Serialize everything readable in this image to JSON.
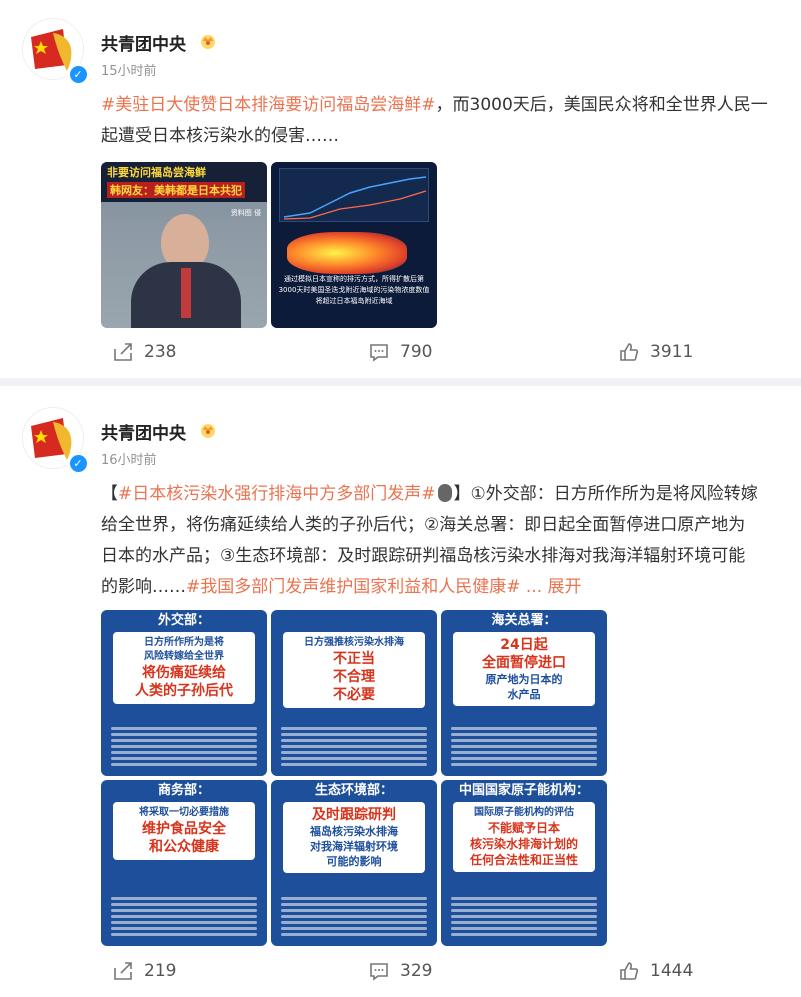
{
  "posts": [
    {
      "username": "共青团中央",
      "time": "15小时前",
      "content": {
        "topic": "#美驻日大使赞日本排海要访问福岛尝海鲜#",
        "text": "，而3000天后，美国民众将和全世界人民一起遭受日本核污染水的侵害……"
      },
      "images": [
        {
          "line1": "非要访问福岛尝海鲜",
          "line2": "韩网友：美韩都是日本共犯",
          "tag": "资料图 侵"
        },
        {
          "caption": "通过模拟日本宣称的排污方式，所得扩散后第3000天时美国圣迭戈附近海域的污染物浓度数值将超过日本福岛附近海域"
        }
      ],
      "actions": {
        "share": "238",
        "comment": "790",
        "like": "3911"
      }
    },
    {
      "username": "共青团中央",
      "time": "16小时前",
      "content": {
        "prefix": "【",
        "topic1": "#日本核污染水强行排海中方多部门发声#",
        "mid": "】①外交部：日方所作所为是将风险转嫁给全世界，将伤痛延续给人类的子孙后代；②海关总署：即日起全面暂停进口原产地为日本的水产品；③生态环境部：及时跟踪研判福岛核污染水排海对我海洋辐射环境可能的影响……",
        "topic2": "#我国多部门发声维护国家利益和人民健康#",
        "expand": "... 展开"
      },
      "cards": [
        {
          "header": "外交部：",
          "lines": [
            "日方所作所为是将",
            "风险转嫁给全世界"
          ],
          "big": [
            "将伤痛延续给",
            "人类的子孙后代"
          ]
        },
        {
          "header": "",
          "lines": [
            "日方强推核污染水排海"
          ],
          "big": [
            "不正当",
            "不合理",
            "不必要"
          ]
        },
        {
          "header": "海关总署：",
          "lines": [],
          "big": [
            "24日起",
            "全面暂停进口"
          ],
          "after": [
            "原产地为日本的",
            "水产品"
          ]
        },
        {
          "header": "商务部：",
          "lines": [
            "将采取一切必要措施"
          ],
          "big": [
            "维护食品安全",
            "和公众健康"
          ]
        },
        {
          "header": "生态环境部：",
          "lines": [],
          "big": [
            "及时跟踪研判"
          ],
          "after": [
            "福岛核污染水排海",
            "对我海洋辐射环境",
            "可能的影响"
          ]
        },
        {
          "header": "中国国家原子能机构：",
          "lines": [
            "国际原子能机构的评估"
          ],
          "big": [
            "不能赋予日本",
            "核污染水排海计划的",
            "任何合法性和正当性"
          ]
        }
      ],
      "actions": {
        "share": "219",
        "comment": "329",
        "like": "1444"
      }
    }
  ],
  "colors": {
    "topic": "#eb7350",
    "verified": "#1a95ff",
    "card_blue": "#1d4f9b",
    "card_red": "#d8341c"
  },
  "icons": {
    "share": "share-icon",
    "comment": "comment-icon",
    "like": "like-icon",
    "crown": "crown-badge-icon",
    "verified": "verified-icon"
  }
}
